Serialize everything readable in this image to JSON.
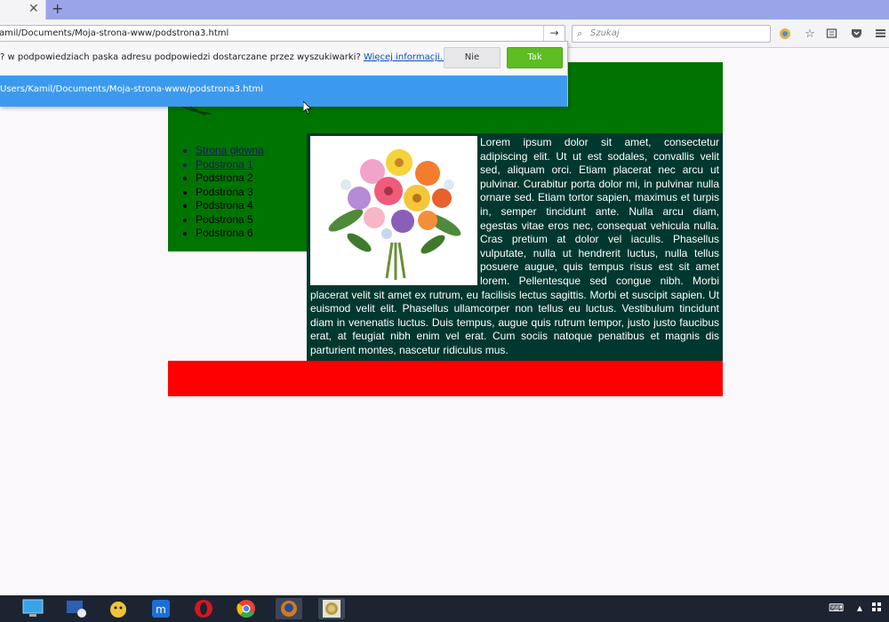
{
  "browser": {
    "tab_close": "✕",
    "new_tab": "+",
    "url": "amil/Documents/Moja-strona-www/podstrona3.html",
    "go_glyph": "→",
    "search_placeholder": "Szukaj",
    "toolbar_icons": [
      "addon-icon",
      "bookmark-star-icon",
      "reading-list-icon",
      "pocket-icon",
      "menu-icon"
    ]
  },
  "dropdown": {
    "question": "? w podpowiedziach paska adresu podpowiedzi dostarczane przez wyszukiwarki? ",
    "more_info_link": "Więcej informacji...",
    "no_label": "Nie",
    "yes_label": "Tak",
    "suggestion_url": "Users/Kamil/Documents/Moja-strona-www/podstrona3.html"
  },
  "site": {
    "menu": [
      {
        "label": "Strona główna",
        "link": true
      },
      {
        "label": "Podstrona 1",
        "link": true
      },
      {
        "label": "Podstrona 2",
        "link": false
      },
      {
        "label": "Podstrona 3",
        "link": false
      },
      {
        "label": "Podstrona 4",
        "link": false
      },
      {
        "label": "Podstrona 5",
        "link": false
      },
      {
        "label": "Podstrona 6",
        "link": false
      }
    ],
    "content": "Lorem ipsum dolor sit amet, consectetur adipiscing elit. Ut ut est sodales, convallis velit sed, aliquam orci. Etiam placerat nec arcu ut pulvinar. Curabitur porta dolor mi, in pulvinar nulla ornare sed. Etiam tortor sapien, maximus et turpis in, semper tincidunt ante. Nulla arcu diam, egestas vitae eros nec, consequat vehicula nulla. Cras pretium at dolor vel iaculis. Phasellus vulputate, nulla ut hendrerit luctus, nulla tellus posuere augue, quis tempus risus est sit amet lorem. Pellentesque sed congue nibh. Morbi placerat velit sit amet ex rutrum, eu facilisis lectus sagittis. Morbi et suscipit sapien. Ut euismod velit elit. Phasellus ullamcorper non tellus eu luctus. Vestibulum tincidunt diam in venenatis luctus. Duis tempus, augue quis rutrum tempor, justo justo faucibus erat, at feugiat nibh enim vel erat. Cum sociis natoque penatibus et magnis dis parturient montes, nascetur ridiculus mus.",
    "colors": {
      "header": "#007400",
      "content_bg": "#00382f",
      "footer": "#ff0000"
    }
  },
  "taskbar": {
    "apps": [
      "this-pc-icon",
      "remote-desktop-icon",
      "winamp-icon",
      "maxthon-icon",
      "opera-icon",
      "chrome-icon",
      "firefox-icon",
      "coin-app-icon"
    ]
  }
}
